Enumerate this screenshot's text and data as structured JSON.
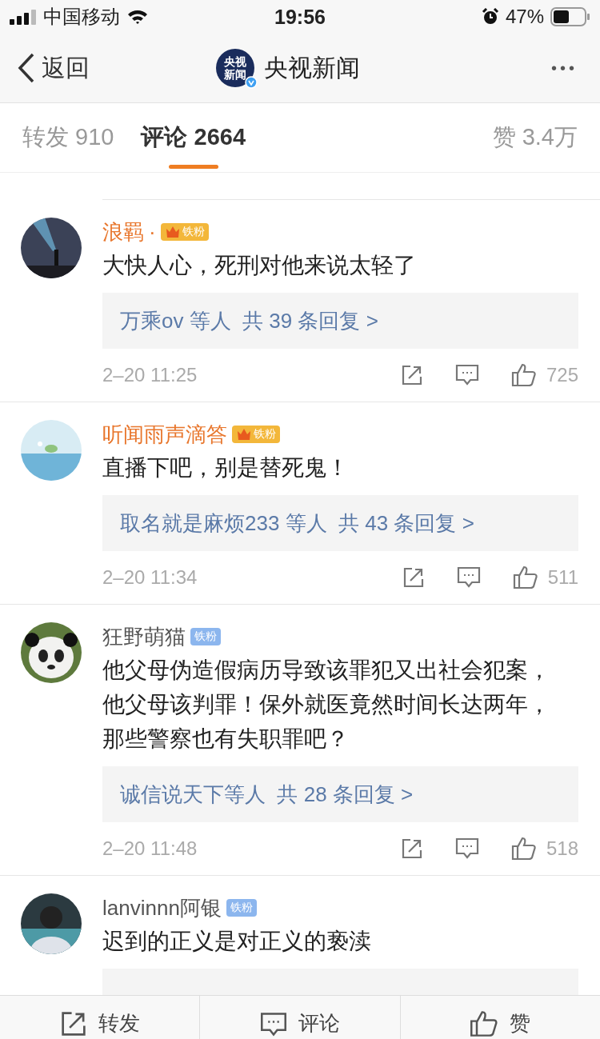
{
  "status_bar": {
    "carrier": "中国移动",
    "time": "19:56",
    "battery": "47%"
  },
  "nav": {
    "back": "返回",
    "logo_lines": [
      "央视",
      "新闻"
    ],
    "title": "央视新闻",
    "more": "•••"
  },
  "tabs": [
    {
      "label": "转发",
      "count": "910",
      "selected": false
    },
    {
      "label": "评论",
      "count": "2664",
      "selected": true
    }
  ],
  "likes_tab": {
    "label": "赞",
    "count": "3.4万"
  },
  "comments": [
    {
      "name": "浪羁",
      "vip": true,
      "dot": "·",
      "badge": {
        "kind": "gold",
        "label": "铁粉"
      },
      "text": "大快人心，死刑对他来说太轻了",
      "reply": {
        "users": "万乘ov 等人",
        "summary": "共 39 条回复 >"
      },
      "time": "2–20 11:25",
      "likes": "725"
    },
    {
      "name": "听闻雨声滴答",
      "vip": true,
      "badge": {
        "kind": "gold",
        "label": "铁粉"
      },
      "text": "直播下吧，别是替死鬼！",
      "reply": {
        "users": "取名就是麻烦233 等人",
        "summary": "共 43 条回复 >"
      },
      "time": "2–20 11:34",
      "likes": "511"
    },
    {
      "name": "狂野萌猫",
      "vip": false,
      "badge": {
        "kind": "blue",
        "label": "铁粉"
      },
      "text": "他父母伪造假病历导致该罪犯又出社会犯案，他父母该判罪！保外就医竟然时间长达两年，那些警察也有失职罪吧？",
      "reply": {
        "users": "诚信说天下等人",
        "summary": "共 28 条回复 >"
      },
      "time": "2–20 11:48",
      "likes": "518"
    },
    {
      "name": "lanvinnn阿银",
      "vip": false,
      "badge": {
        "kind": "blue",
        "label": "铁粉"
      },
      "text": "迟到的正义是对正义的亵渎",
      "reply_box": true
    }
  ],
  "bottom_bar": [
    {
      "kind": "share",
      "label": "转发"
    },
    {
      "kind": "comment",
      "label": "评论"
    },
    {
      "kind": "like",
      "label": "赞"
    }
  ]
}
